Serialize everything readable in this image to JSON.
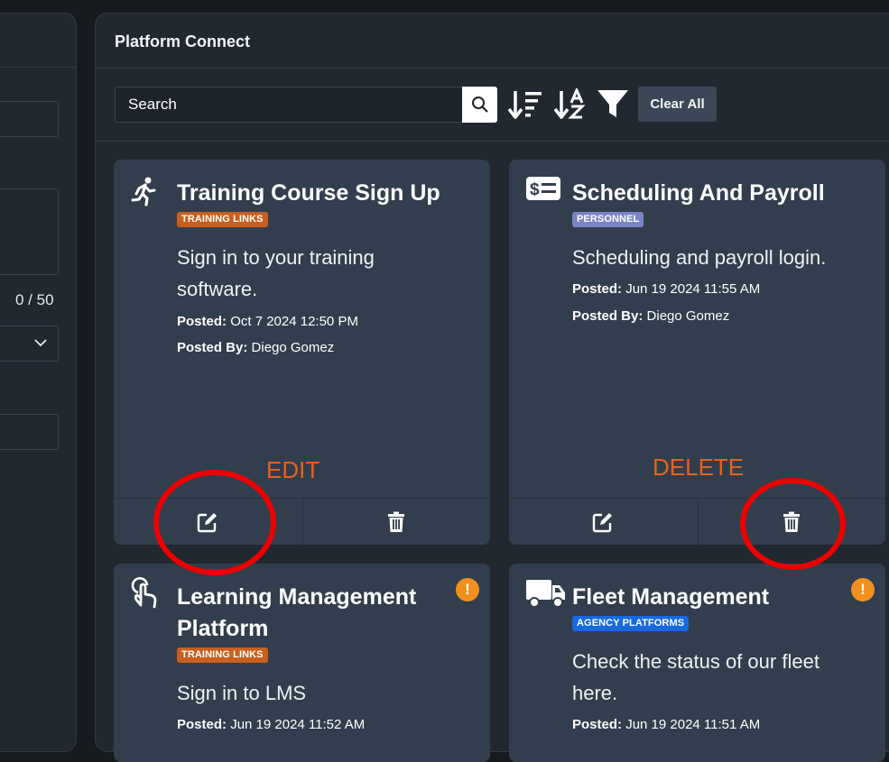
{
  "left_panel": {
    "char_count": "0 / 50"
  },
  "panel": {
    "title": "Platform Connect"
  },
  "toolbar": {
    "search_placeholder": "Search",
    "clear_label": "Clear All",
    "icons": [
      "search-icon",
      "sort-descending-icon",
      "sort-alpha-icon",
      "filter-icon"
    ]
  },
  "cards": [
    {
      "title": "Training Course Sign Up",
      "icon": "running-person-icon",
      "badge": "TRAINING LINKS",
      "description": "Sign in to your training software.",
      "posted_label": "Posted:",
      "posted": "Oct 7 2024 12:50 PM",
      "posted_by_label": "Posted By:",
      "posted_by": "Diego Gomez"
    },
    {
      "title": "Scheduling And Payroll",
      "icon": "money-bill-icon",
      "badge": "PERSONNEL",
      "description": "Scheduling and payroll login.",
      "posted_label": "Posted:",
      "posted": "Jun 19 2024 11:55 AM",
      "posted_by_label": "Posted By:",
      "posted_by": "Diego Gomez"
    },
    {
      "title": "Learning Management Platform",
      "icon": "hand-pointer-icon",
      "badge": "TRAINING LINKS",
      "description": "Sign in to LMS",
      "posted_label": "Posted:",
      "posted": "Jun 19 2024 11:52 AM",
      "warning": "!"
    },
    {
      "title": "Fleet Management",
      "icon": "truck-icon",
      "badge": "AGENCY PLATFORMS",
      "description": "Check the status of our fleet here.",
      "posted_label": "Posted:",
      "posted": "Jun 19 2024 11:51 AM",
      "warning": "!"
    }
  ],
  "annotations": {
    "edit": "EDIT",
    "delete": "DELETE"
  },
  "colors": {
    "background": "#16191d",
    "panel": "#222830",
    "card": "#323e4d",
    "badge_training": "#c85f1e",
    "badge_personnel": "#7a85c6",
    "badge_agency": "#1769df",
    "warning": "#f2901d",
    "annotation_text": "#e8621a",
    "annotation_circle": "#ee0000"
  }
}
